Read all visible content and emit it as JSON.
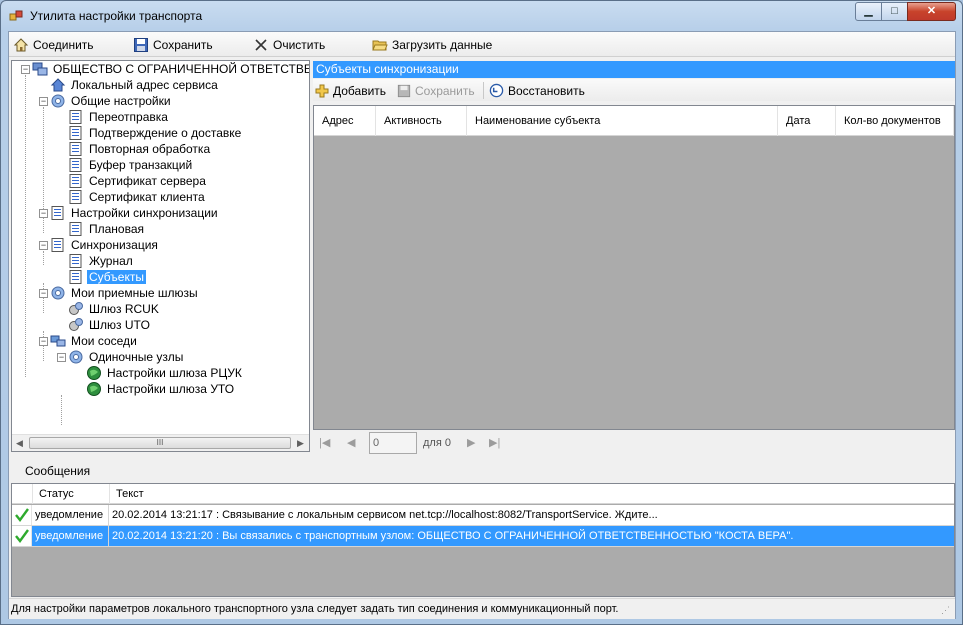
{
  "window": {
    "title": "Утилита настройки транспорта",
    "min_label": "▁",
    "max_label": "□",
    "close_label": "✕"
  },
  "toolbar": {
    "connect_label": "Соединить",
    "save_label": "Сохранить",
    "clear_label": "Очистить",
    "load_label": "Загрузить данные"
  },
  "tree": {
    "root": "ОБЩЕСТВО С ОГРАНИЧЕННОЙ ОТВЕТСТВЕННОСТЬ",
    "local_address": "Локальный адрес сервиса",
    "general": "Общие настройки",
    "resend": "Переотправка",
    "delivery_confirm": "Подтверждение о доставке",
    "reprocess": "Повторная обработка",
    "tx_buffer": "Буфер транзакций",
    "server_cert": "Сертификат сервера",
    "client_cert": "Сертификат клиента",
    "sync_settings": "Настройки синхронизации",
    "planned": "Плановая",
    "sync": "Синхронизация",
    "journal": "Журнал",
    "subjects": "Субъекты",
    "gateways": "Мои приемные шлюзы",
    "gw_rcuk": "Шлюз RCUK",
    "gw_uto": "Шлюз UTO",
    "neighbors": "Мои соседи",
    "single_nodes": "Одиночные узлы",
    "gw_settings_rcuk": "Настройки шлюза РЦУК",
    "gw_settings_uto": "Настройки шлюза УТО",
    "scroll_thumb": "III"
  },
  "panel": {
    "header": "Субъекты синхронизации",
    "add_label": "Добавить",
    "save_label": "Сохранить",
    "restore_label": "Восстановить",
    "columns": [
      "Адрес",
      "Активность",
      "Наименование субъекта",
      "Дата",
      "Кол-во документов"
    ]
  },
  "pager": {
    "page_value": "0",
    "of_label": "для 0"
  },
  "messages": {
    "label": "Сообщения",
    "columns": [
      "Статус",
      "Текст"
    ],
    "rows": [
      {
        "status": "уведомление",
        "text": "20.02.2014 13:21:17 : Связывание с локальным сервисом net.tcp://localhost:8082/TransportService. Ждите..."
      },
      {
        "status": "уведомление",
        "text": "20.02.2014 13:21:20 : Вы связались с транспортным узлом: ОБЩЕСТВО С ОГРАНИЧЕННОЙ ОТВЕТСТВЕННОСТЬЮ \"КОСТА ВЕРА\"."
      }
    ]
  },
  "statusbar": {
    "text": "Для настройки параметров локального транспортного узла следует задать тип соединения и коммуникационный порт."
  },
  "colors": {
    "selection": "#3399ff",
    "grid_bg": "#ababab",
    "check": "#2eaa2e"
  }
}
